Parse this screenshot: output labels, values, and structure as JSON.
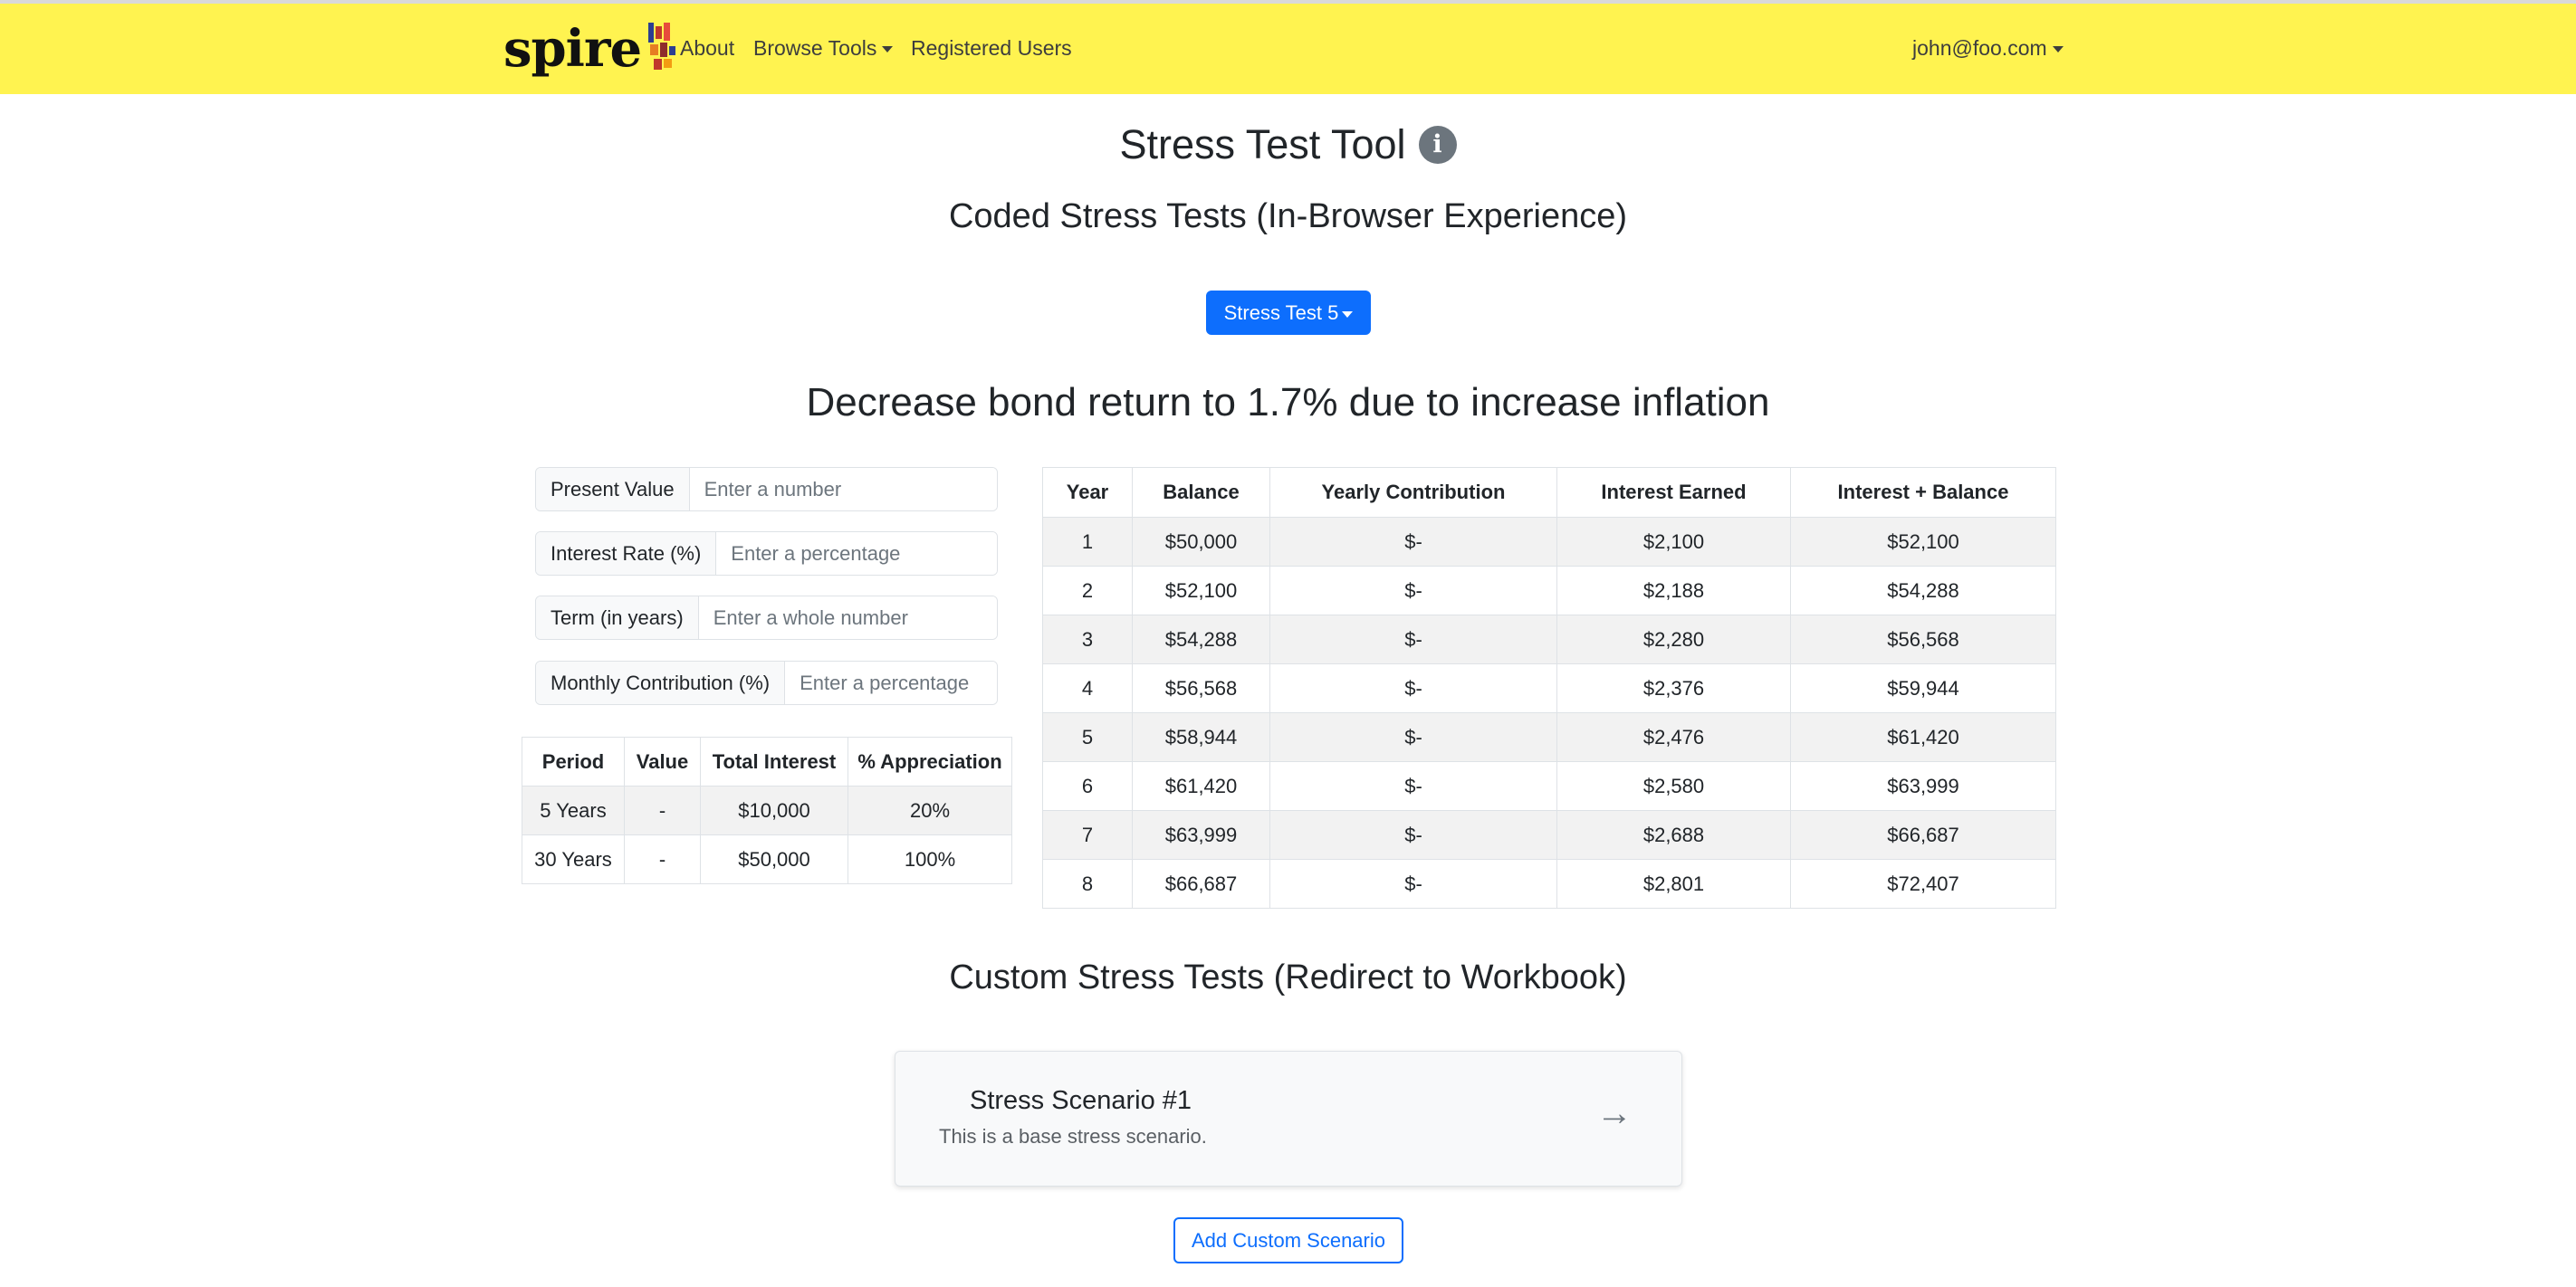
{
  "nav": {
    "brand": "spire",
    "links": [
      "About",
      "Browse Tools",
      "Registered Users"
    ],
    "user": "john@foo.com"
  },
  "page": {
    "title": "Stress Test Tool",
    "coded_heading": "Coded Stress Tests (In-Browser Experience)",
    "dropdown_label": "Stress Test 5",
    "scenario_title": "Decrease bond return to 1.7% due to increase inflation",
    "custom_heading": "Custom Stress Tests (Redirect to Workbook)",
    "add_button": "Add Custom Scenario"
  },
  "inputs": [
    {
      "label": "Present Value",
      "placeholder": "Enter a number"
    },
    {
      "label": "Interest Rate (%)",
      "placeholder": "Enter a percentage"
    },
    {
      "label": "Term (in years)",
      "placeholder": "Enter a whole number"
    },
    {
      "label": "Monthly Contribution (%)",
      "placeholder": "Enter a percentage"
    }
  ],
  "summary_table": {
    "headers": [
      "Period",
      "Value",
      "Total Interest",
      "% Appreciation"
    ],
    "rows": [
      [
        "5 Years",
        "-",
        "$10,000",
        "20%"
      ],
      [
        "30 Years",
        "-",
        "$50,000",
        "100%"
      ]
    ]
  },
  "year_table": {
    "headers": [
      "Year",
      "Balance",
      "Yearly Contribution",
      "Interest Earned",
      "Interest + Balance"
    ],
    "rows": [
      [
        "1",
        "$50,000",
        "$-",
        "$2,100",
        "$52,100"
      ],
      [
        "2",
        "$52,100",
        "$-",
        "$2,188",
        "$54,288"
      ],
      [
        "3",
        "$54,288",
        "$-",
        "$2,280",
        "$56,568"
      ],
      [
        "4",
        "$56,568",
        "$-",
        "$2,376",
        "$59,944"
      ],
      [
        "5",
        "$58,944",
        "$-",
        "$2,476",
        "$61,420"
      ],
      [
        "6",
        "$61,420",
        "$-",
        "$2,580",
        "$63,999"
      ],
      [
        "7",
        "$63,999",
        "$-",
        "$2,688",
        "$66,687"
      ],
      [
        "8",
        "$66,687",
        "$-",
        "$2,801",
        "$72,407"
      ]
    ]
  },
  "scenario_card": {
    "title": "Stress Scenario #1",
    "description": "This is a base stress scenario.",
    "arrow": "→"
  },
  "icons": {
    "info": "info-icon",
    "logo": "spire-logo-mark",
    "card_arrow": "arrow-right-icon"
  },
  "colors": {
    "navbar": "#fff350",
    "primary": "#0d6efd",
    "info_icon": "#6c757d"
  }
}
